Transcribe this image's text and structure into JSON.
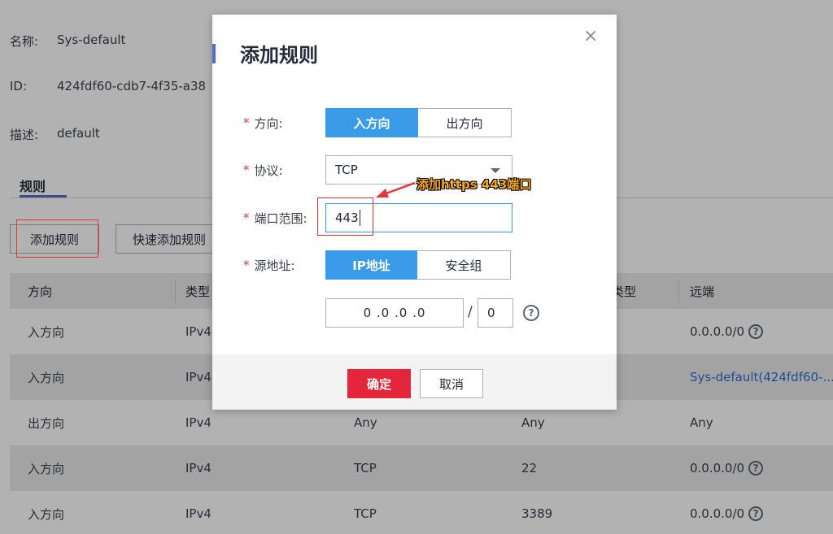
{
  "info": {
    "name_label": "名称:",
    "name_value": "Sys-default",
    "id_label": "ID:",
    "id_value": "424fdf60-cdb7-4f35-a38",
    "desc_label": "描述:",
    "desc_value": "default"
  },
  "tabs": {
    "active": "规则"
  },
  "toolbar": {
    "add_rule": "添加规则",
    "quick_add_rule": "快速添加规则"
  },
  "table": {
    "headers": [
      "方向",
      "类型",
      "",
      "类型",
      "远端"
    ],
    "rows": [
      {
        "direction": "入方向",
        "type": "IPv4",
        "protocol": "",
        "port": "",
        "remote": "0.0.0.0/0",
        "remote_help": true,
        "remote_link": false
      },
      {
        "direction": "入方向",
        "type": "IPv4",
        "protocol": "",
        "port": "",
        "remote": "Sys-default(424fdf60-...",
        "remote_help": false,
        "remote_link": true
      },
      {
        "direction": "出方向",
        "type": "IPv4",
        "protocol": "Any",
        "port": "Any",
        "remote": "Any",
        "remote_help": false,
        "remote_link": false
      },
      {
        "direction": "入方向",
        "type": "IPv4",
        "protocol": "TCP",
        "port": "22",
        "remote": "0.0.0.0/0",
        "remote_help": true,
        "remote_link": false
      },
      {
        "direction": "入方向",
        "type": "IPv4",
        "protocol": "TCP",
        "port": "3389",
        "remote": "0.0.0.0/0",
        "remote_help": true,
        "remote_link": false
      }
    ]
  },
  "modal": {
    "title": "添加规则",
    "close_glyph": "×",
    "required_mark": "*",
    "direction_label": "方向:",
    "direction_options": [
      "入方向",
      "出方向"
    ],
    "direction_selected": "入方向",
    "protocol_label": "协议:",
    "protocol_value": "TCP",
    "port_label": "端口范围:",
    "port_value": "443",
    "source_label": "源地址:",
    "source_options": [
      "IP地址",
      "安全组"
    ],
    "source_selected": "IP地址",
    "ip_value": "0 .0 .0 .0",
    "slash": "/",
    "mask_value": "0",
    "help_glyph": "?",
    "ok_button": "确定",
    "cancel_button": "取消"
  },
  "annotation": {
    "text": "添加https 443端口",
    "color": "#f5a623"
  },
  "colors": {
    "primary": "#3a9be8",
    "danger": "#e5253c",
    "link": "#2b6cd9",
    "highlight": "#e5353c"
  }
}
